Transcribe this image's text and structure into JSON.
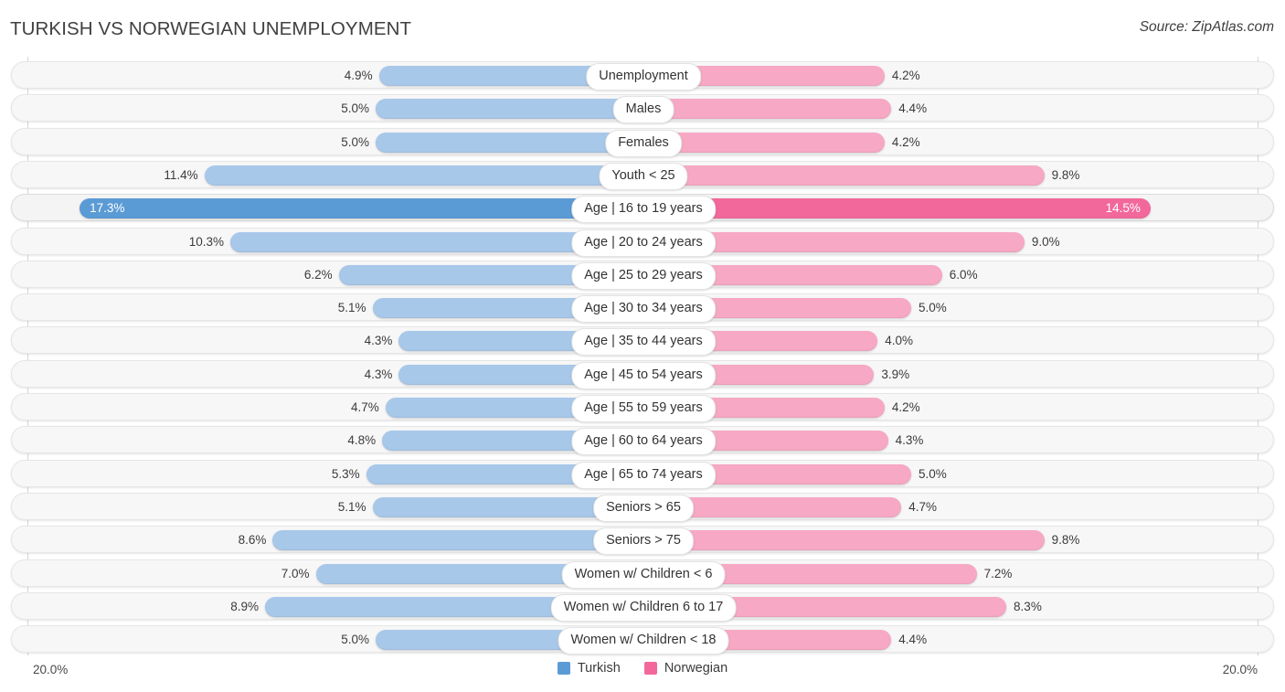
{
  "header": {
    "title": "TURKISH VS NORWEGIAN UNEMPLOYMENT",
    "source": "Source: ZipAtlas.com"
  },
  "axis": {
    "left_label": "20.0%",
    "right_label": "20.0%"
  },
  "legend": {
    "items": [
      {
        "label": "Turkish",
        "color": "#5b9bd5"
      },
      {
        "label": "Norwegian",
        "color": "#f2689a"
      }
    ]
  },
  "colors": {
    "left_bar": "#a8c8ea",
    "left_bar_highlight": "#5b9bd5",
    "right_bar": "#f7a8c4",
    "right_bar_highlight": "#f2689a",
    "row_track": "#f7f7f7",
    "gridline": "#d6d6d6"
  },
  "chart_data": {
    "type": "bar",
    "title": "TURKISH VS NORWEGIAN UNEMPLOYMENT",
    "subtitle": "",
    "xlabel": "",
    "ylabel": "",
    "orientation": "horizontal-diverging",
    "axis_max": 20.0,
    "axis_unit": "%",
    "grid": true,
    "legend_position": "bottom-center",
    "categories": [
      "Unemployment",
      "Males",
      "Females",
      "Youth < 25",
      "Age | 16 to 19 years",
      "Age | 20 to 24 years",
      "Age | 25 to 29 years",
      "Age | 30 to 34 years",
      "Age | 35 to 44 years",
      "Age | 45 to 54 years",
      "Age | 55 to 59 years",
      "Age | 60 to 64 years",
      "Age | 65 to 74 years",
      "Seniors > 65",
      "Seniors > 75",
      "Women w/ Children < 6",
      "Women w/ Children 6 to 17",
      "Women w/ Children < 18"
    ],
    "series": [
      {
        "name": "Turkish",
        "side": "left",
        "color": "#a8c8ea",
        "values": [
          4.9,
          5.0,
          5.0,
          11.4,
          17.3,
          10.3,
          6.2,
          5.1,
          4.3,
          4.3,
          4.7,
          4.8,
          5.3,
          5.1,
          8.6,
          7.0,
          8.9,
          5.0
        ],
        "labels": [
          "4.9%",
          "5.0%",
          "5.0%",
          "11.4%",
          "17.3%",
          "10.3%",
          "6.2%",
          "5.1%",
          "4.3%",
          "4.3%",
          "4.7%",
          "4.8%",
          "5.3%",
          "5.1%",
          "8.6%",
          "7.0%",
          "8.9%",
          "5.0%"
        ]
      },
      {
        "name": "Norwegian",
        "side": "right",
        "color": "#f7a8c4",
        "values": [
          4.2,
          4.4,
          4.2,
          9.8,
          14.5,
          9.0,
          6.0,
          5.0,
          4.0,
          3.9,
          4.2,
          4.3,
          5.0,
          4.7,
          9.8,
          7.2,
          8.3,
          4.4
        ],
        "labels": [
          "4.2%",
          "4.4%",
          "4.2%",
          "9.8%",
          "14.5%",
          "9.0%",
          "6.0%",
          "5.0%",
          "4.0%",
          "3.9%",
          "4.2%",
          "4.3%",
          "5.0%",
          "4.7%",
          "9.8%",
          "7.2%",
          "8.3%",
          "4.4%"
        ]
      }
    ],
    "highlight_row_index": 4
  }
}
